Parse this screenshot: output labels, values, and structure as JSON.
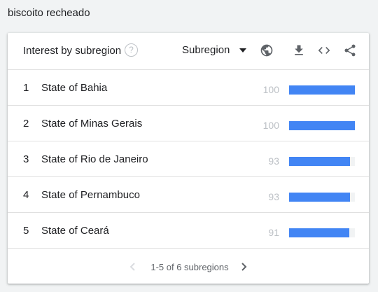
{
  "search_term": "biscoito recheado",
  "widget": {
    "title": "Interest by subregion",
    "help_icon": "?",
    "dropdown": {
      "selected": "Subregion"
    },
    "icons": [
      "help-icon",
      "globe-icon",
      "download-icon",
      "embed-code-icon",
      "share-icon"
    ]
  },
  "rows": [
    {
      "rank": "1",
      "name": "State of Bahia",
      "value": "100",
      "fill": 100
    },
    {
      "rank": "2",
      "name": "State of Minas Gerais",
      "value": "100",
      "fill": 100
    },
    {
      "rank": "3",
      "name": "State of Rio de Janeiro",
      "value": "93",
      "fill": 93
    },
    {
      "rank": "4",
      "name": "State of Pernambuco",
      "value": "93",
      "fill": 93
    },
    {
      "rank": "5",
      "name": "State of Ceará",
      "value": "91",
      "fill": 91
    }
  ],
  "pagination": {
    "label": "1-5 of 6 subregions"
  },
  "colors": {
    "bar": "#4285f4",
    "track": "#f1f3f4",
    "muted": "#bdc1c6"
  }
}
